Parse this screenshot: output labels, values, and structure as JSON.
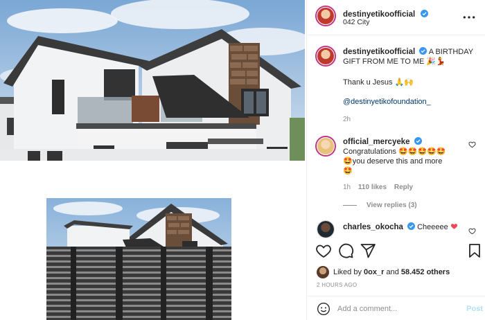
{
  "post": {
    "author": "destinyetikoofficial",
    "location": "042 City"
  },
  "caption": {
    "author": "destinyetikoofficial",
    "line1": "A BIRTHDAY",
    "line2": "GIFT FROM ME TO ME",
    "thanks": "Thank u Jesus",
    "mention": "@destinyetikofoundation_",
    "age": "2h"
  },
  "comments": [
    {
      "author": "official_mercyeke",
      "text_line1": "Congratulations",
      "text_line2": "you deserve this and more",
      "age": "1h",
      "likes": "110 likes",
      "reply": "Reply",
      "view_replies": "View replies (3)"
    },
    {
      "author": "charles_okocha",
      "text": "Cheeeee"
    }
  ],
  "likes": {
    "prefix": "Liked by",
    "user": "0ox_r",
    "conj": "and",
    "count": "58.452 others"
  },
  "timestamp": "2 HOURS AGO",
  "composer": {
    "placeholder": "Add a comment...",
    "post_label": "Post"
  },
  "colors": {
    "verified": "#3897f0",
    "heart_red": "#ed4956",
    "post_disabled": "#b2dffc",
    "story_ring": "#c13584"
  },
  "icons": [
    "more-icon",
    "heart-icon",
    "comment-icon",
    "share-icon",
    "bookmark-icon",
    "emoji-icon",
    "verified-icon"
  ]
}
